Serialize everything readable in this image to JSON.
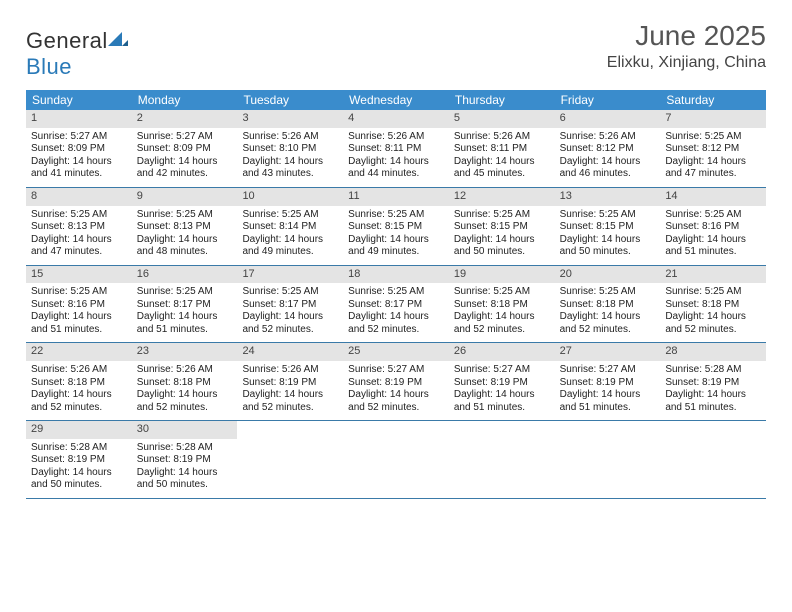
{
  "logo": {
    "text_left": "General",
    "text_right": "Blue"
  },
  "header": {
    "title": "June 2025",
    "location": "Elixku, Xinjiang, China"
  },
  "days_of_week": [
    "Sunday",
    "Monday",
    "Tuesday",
    "Wednesday",
    "Thursday",
    "Friday",
    "Saturday"
  ],
  "weeks": [
    [
      {
        "n": "1",
        "sr": "Sunrise: 5:27 AM",
        "ss": "Sunset: 8:09 PM",
        "dl": "Daylight: 14 hours and 41 minutes."
      },
      {
        "n": "2",
        "sr": "Sunrise: 5:27 AM",
        "ss": "Sunset: 8:09 PM",
        "dl": "Daylight: 14 hours and 42 minutes."
      },
      {
        "n": "3",
        "sr": "Sunrise: 5:26 AM",
        "ss": "Sunset: 8:10 PM",
        "dl": "Daylight: 14 hours and 43 minutes."
      },
      {
        "n": "4",
        "sr": "Sunrise: 5:26 AM",
        "ss": "Sunset: 8:11 PM",
        "dl": "Daylight: 14 hours and 44 minutes."
      },
      {
        "n": "5",
        "sr": "Sunrise: 5:26 AM",
        "ss": "Sunset: 8:11 PM",
        "dl": "Daylight: 14 hours and 45 minutes."
      },
      {
        "n": "6",
        "sr": "Sunrise: 5:26 AM",
        "ss": "Sunset: 8:12 PM",
        "dl": "Daylight: 14 hours and 46 minutes."
      },
      {
        "n": "7",
        "sr": "Sunrise: 5:25 AM",
        "ss": "Sunset: 8:12 PM",
        "dl": "Daylight: 14 hours and 47 minutes."
      }
    ],
    [
      {
        "n": "8",
        "sr": "Sunrise: 5:25 AM",
        "ss": "Sunset: 8:13 PM",
        "dl": "Daylight: 14 hours and 47 minutes."
      },
      {
        "n": "9",
        "sr": "Sunrise: 5:25 AM",
        "ss": "Sunset: 8:13 PM",
        "dl": "Daylight: 14 hours and 48 minutes."
      },
      {
        "n": "10",
        "sr": "Sunrise: 5:25 AM",
        "ss": "Sunset: 8:14 PM",
        "dl": "Daylight: 14 hours and 49 minutes."
      },
      {
        "n": "11",
        "sr": "Sunrise: 5:25 AM",
        "ss": "Sunset: 8:15 PM",
        "dl": "Daylight: 14 hours and 49 minutes."
      },
      {
        "n": "12",
        "sr": "Sunrise: 5:25 AM",
        "ss": "Sunset: 8:15 PM",
        "dl": "Daylight: 14 hours and 50 minutes."
      },
      {
        "n": "13",
        "sr": "Sunrise: 5:25 AM",
        "ss": "Sunset: 8:15 PM",
        "dl": "Daylight: 14 hours and 50 minutes."
      },
      {
        "n": "14",
        "sr": "Sunrise: 5:25 AM",
        "ss": "Sunset: 8:16 PM",
        "dl": "Daylight: 14 hours and 51 minutes."
      }
    ],
    [
      {
        "n": "15",
        "sr": "Sunrise: 5:25 AM",
        "ss": "Sunset: 8:16 PM",
        "dl": "Daylight: 14 hours and 51 minutes."
      },
      {
        "n": "16",
        "sr": "Sunrise: 5:25 AM",
        "ss": "Sunset: 8:17 PM",
        "dl": "Daylight: 14 hours and 51 minutes."
      },
      {
        "n": "17",
        "sr": "Sunrise: 5:25 AM",
        "ss": "Sunset: 8:17 PM",
        "dl": "Daylight: 14 hours and 52 minutes."
      },
      {
        "n": "18",
        "sr": "Sunrise: 5:25 AM",
        "ss": "Sunset: 8:17 PM",
        "dl": "Daylight: 14 hours and 52 minutes."
      },
      {
        "n": "19",
        "sr": "Sunrise: 5:25 AM",
        "ss": "Sunset: 8:18 PM",
        "dl": "Daylight: 14 hours and 52 minutes."
      },
      {
        "n": "20",
        "sr": "Sunrise: 5:25 AM",
        "ss": "Sunset: 8:18 PM",
        "dl": "Daylight: 14 hours and 52 minutes."
      },
      {
        "n": "21",
        "sr": "Sunrise: 5:25 AM",
        "ss": "Sunset: 8:18 PM",
        "dl": "Daylight: 14 hours and 52 minutes."
      }
    ],
    [
      {
        "n": "22",
        "sr": "Sunrise: 5:26 AM",
        "ss": "Sunset: 8:18 PM",
        "dl": "Daylight: 14 hours and 52 minutes."
      },
      {
        "n": "23",
        "sr": "Sunrise: 5:26 AM",
        "ss": "Sunset: 8:18 PM",
        "dl": "Daylight: 14 hours and 52 minutes."
      },
      {
        "n": "24",
        "sr": "Sunrise: 5:26 AM",
        "ss": "Sunset: 8:19 PM",
        "dl": "Daylight: 14 hours and 52 minutes."
      },
      {
        "n": "25",
        "sr": "Sunrise: 5:27 AM",
        "ss": "Sunset: 8:19 PM",
        "dl": "Daylight: 14 hours and 52 minutes."
      },
      {
        "n": "26",
        "sr": "Sunrise: 5:27 AM",
        "ss": "Sunset: 8:19 PM",
        "dl": "Daylight: 14 hours and 51 minutes."
      },
      {
        "n": "27",
        "sr": "Sunrise: 5:27 AM",
        "ss": "Sunset: 8:19 PM",
        "dl": "Daylight: 14 hours and 51 minutes."
      },
      {
        "n": "28",
        "sr": "Sunrise: 5:28 AM",
        "ss": "Sunset: 8:19 PM",
        "dl": "Daylight: 14 hours and 51 minutes."
      }
    ],
    [
      {
        "n": "29",
        "sr": "Sunrise: 5:28 AM",
        "ss": "Sunset: 8:19 PM",
        "dl": "Daylight: 14 hours and 50 minutes."
      },
      {
        "n": "30",
        "sr": "Sunrise: 5:28 AM",
        "ss": "Sunset: 8:19 PM",
        "dl": "Daylight: 14 hours and 50 minutes."
      },
      {
        "n": "",
        "sr": "",
        "ss": "",
        "dl": ""
      },
      {
        "n": "",
        "sr": "",
        "ss": "",
        "dl": ""
      },
      {
        "n": "",
        "sr": "",
        "ss": "",
        "dl": ""
      },
      {
        "n": "",
        "sr": "",
        "ss": "",
        "dl": ""
      },
      {
        "n": "",
        "sr": "",
        "ss": "",
        "dl": ""
      }
    ]
  ]
}
